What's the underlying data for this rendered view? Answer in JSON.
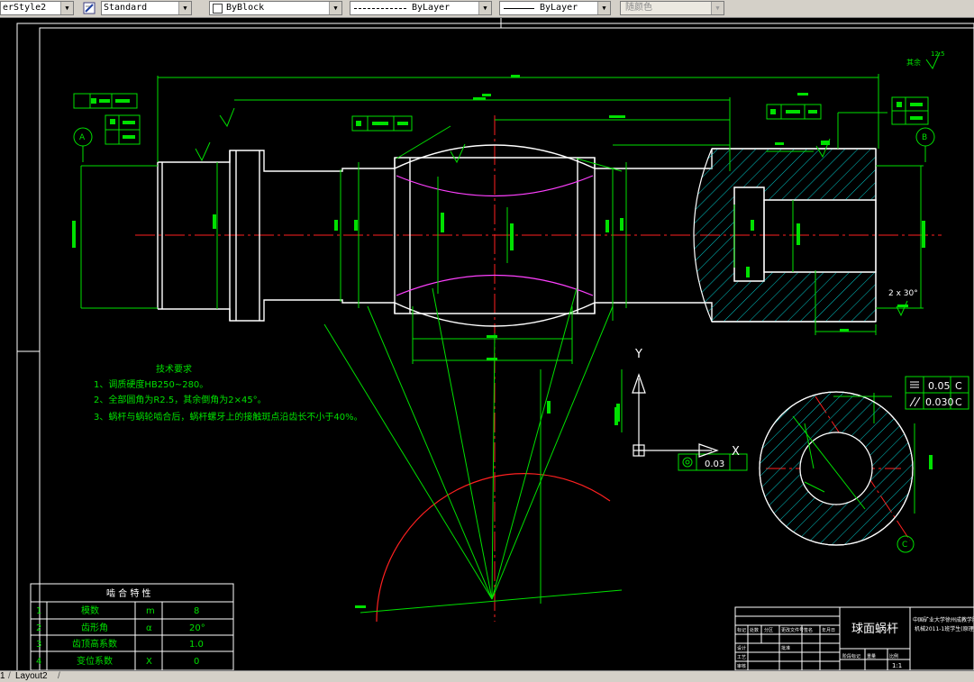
{
  "toolbar": {
    "text_style": "erStyle2",
    "dim_style": "Standard",
    "layer_color": "ByBlock",
    "linetype": "ByLayer",
    "lineweight": "ByLayer",
    "plot_color": "随颜色"
  },
  "drawing": {
    "surface_finish": "其余",
    "surface_finish_value": "12.5",
    "datum_a": "A",
    "datum_b": "B",
    "datum_c": "C",
    "tech_title": "技术要求",
    "tech_items": [
      "1、调质硬度HB250~280。",
      "2、全部圆角为R2.5，其余倒角为2×45°。",
      "3、蜗杆与蜗轮啮合后，蜗杆螺牙上的接触斑点沿齿长不小于40%。"
    ],
    "tol_flat": "0.05",
    "tol_parallel": "0.030",
    "tol_ref": "C",
    "chamfer_note": "2 x 30°",
    "runout_value": "0.03",
    "axis_x": "X",
    "axis_y": "Y"
  },
  "mesh_table": {
    "title": "啮 合 特 性",
    "rows": [
      {
        "no": "1",
        "name": "模数",
        "sym": "m",
        "val": "8"
      },
      {
        "no": "2",
        "name": "齿形角",
        "sym": "α",
        "val": "20°"
      },
      {
        "no": "3",
        "name": "齿顶高系数",
        "sym": "",
        "val": "1.0"
      },
      {
        "no": "4",
        "name": "变位系数",
        "sym": "X",
        "val": "0"
      }
    ]
  },
  "title_block": {
    "part_name": "球面蜗杆",
    "school": "中国矿业大学徐州成教学院",
    "school_sub": "机械2011-1班学生(原理)",
    "scale": "1:1",
    "labels": [
      "标记",
      "处数",
      "分区",
      "更改文件号",
      "签名",
      "年月日",
      "设计",
      "工艺",
      "审核",
      "批准",
      "阶段标记",
      "重量",
      "比例"
    ]
  },
  "tabs": {
    "layout1": "1",
    "layout2": "Layout2"
  }
}
